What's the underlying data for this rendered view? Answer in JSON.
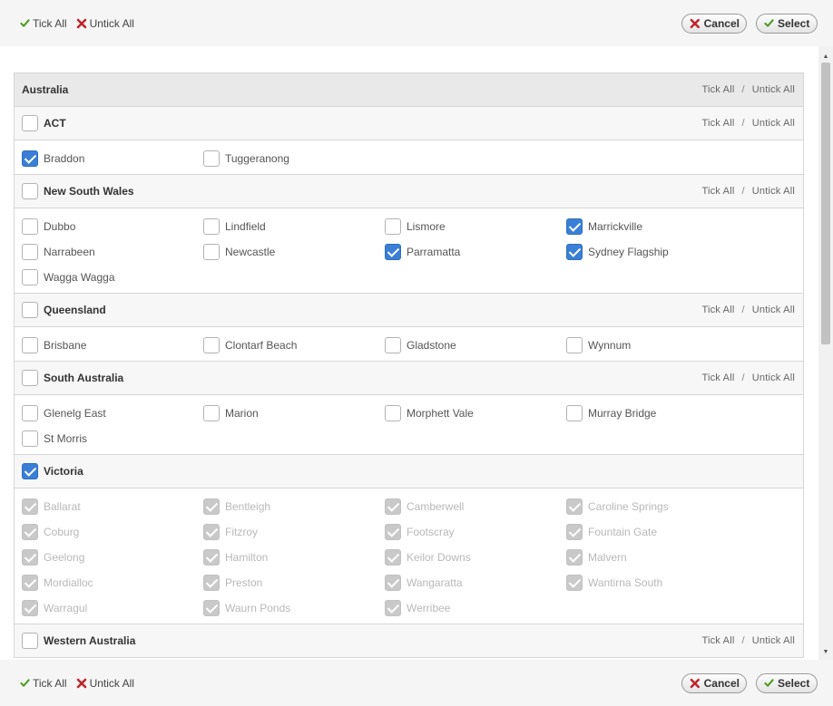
{
  "toolbar": {
    "tick_all": "Tick All",
    "untick_all": "Untick All",
    "cancel": "Cancel",
    "select": "Select"
  },
  "colors": {
    "accent": "#3a7fd5",
    "cancel_icon": "#c0262d",
    "tick_icon": "#4a9a1c"
  },
  "icons": {
    "tick": "check-icon",
    "untick": "x-icon"
  },
  "panel": {
    "title": "Australia",
    "tick_all": "Tick All",
    "sep": "/",
    "untick_all": "Untick All"
  },
  "groups": [
    {
      "name": "ACT",
      "checked": false,
      "show_actions": true,
      "items": [
        {
          "label": "Braddon",
          "state": "checked"
        },
        {
          "label": "Tuggeranong",
          "state": "unchecked"
        }
      ]
    },
    {
      "name": "New South Wales",
      "checked": false,
      "show_actions": true,
      "items": [
        {
          "label": "Dubbo",
          "state": "unchecked"
        },
        {
          "label": "Lindfield",
          "state": "unchecked"
        },
        {
          "label": "Lismore",
          "state": "unchecked"
        },
        {
          "label": "Marrickville",
          "state": "checked"
        },
        {
          "label": "Narrabeen",
          "state": "unchecked"
        },
        {
          "label": "Newcastle",
          "state": "unchecked"
        },
        {
          "label": "Parramatta",
          "state": "checked"
        },
        {
          "label": "Sydney Flagship",
          "state": "checked"
        },
        {
          "label": "Wagga Wagga",
          "state": "unchecked"
        }
      ]
    },
    {
      "name": "Queensland",
      "checked": false,
      "show_actions": true,
      "items": [
        {
          "label": "Brisbane",
          "state": "unchecked"
        },
        {
          "label": "Clontarf Beach",
          "state": "unchecked"
        },
        {
          "label": "Gladstone",
          "state": "unchecked"
        },
        {
          "label": "Wynnum",
          "state": "unchecked"
        }
      ]
    },
    {
      "name": "South Australia",
      "checked": false,
      "show_actions": true,
      "items": [
        {
          "label": "Glenelg East",
          "state": "unchecked"
        },
        {
          "label": "Marion",
          "state": "unchecked"
        },
        {
          "label": "Morphett Vale",
          "state": "unchecked"
        },
        {
          "label": "Murray Bridge",
          "state": "unchecked"
        },
        {
          "label": "St Morris",
          "state": "unchecked"
        }
      ]
    },
    {
      "name": "Victoria",
      "checked": true,
      "show_actions": false,
      "items": [
        {
          "label": "Ballarat",
          "state": "disabled"
        },
        {
          "label": "Bentleigh",
          "state": "disabled"
        },
        {
          "label": "Camberwell",
          "state": "disabled"
        },
        {
          "label": "Caroline Springs",
          "state": "disabled"
        },
        {
          "label": "Coburg",
          "state": "disabled"
        },
        {
          "label": "Fitzroy",
          "state": "disabled"
        },
        {
          "label": "Footscray",
          "state": "disabled"
        },
        {
          "label": "Fountain Gate",
          "state": "disabled"
        },
        {
          "label": "Geelong",
          "state": "disabled"
        },
        {
          "label": "Hamilton",
          "state": "disabled"
        },
        {
          "label": "Keilor Downs",
          "state": "disabled"
        },
        {
          "label": "Malvern",
          "state": "disabled"
        },
        {
          "label": "Mordialloc",
          "state": "disabled"
        },
        {
          "label": "Preston",
          "state": "disabled"
        },
        {
          "label": "Wangaratta",
          "state": "disabled"
        },
        {
          "label": "Wantirna South",
          "state": "disabled"
        },
        {
          "label": "Warragul",
          "state": "disabled"
        },
        {
          "label": "Waurn Ponds",
          "state": "disabled"
        },
        {
          "label": "Werribee",
          "state": "disabled"
        }
      ]
    },
    {
      "name": "Western Australia",
      "checked": false,
      "show_actions": true,
      "items": []
    }
  ]
}
